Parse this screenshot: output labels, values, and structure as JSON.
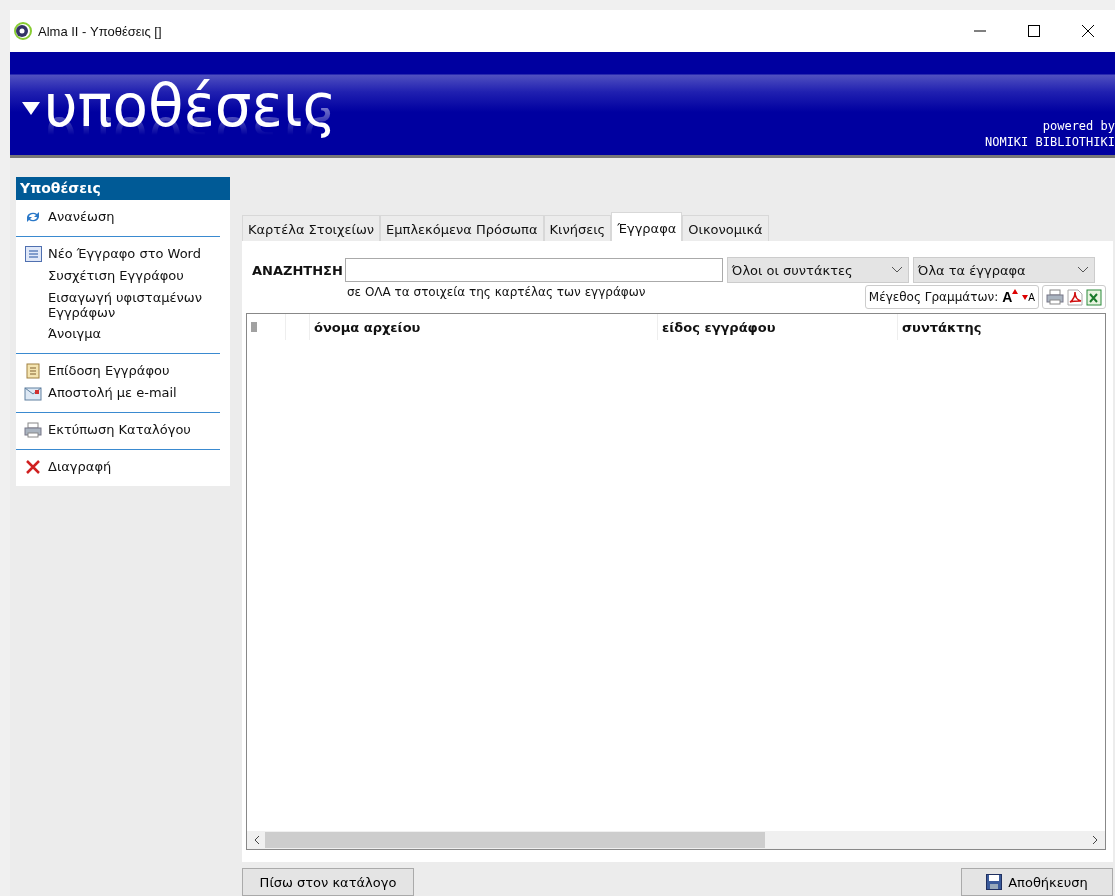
{
  "window": {
    "title": "Alma II - Υποθέσεις []"
  },
  "banner": {
    "title": "υποθέσεις",
    "powered_by": "powered by",
    "brand": "NOMIKI BIBLIOTHIKI"
  },
  "sidebar": {
    "title": "Υποθέσεις",
    "groups": [
      [
        {
          "label": "Ανανέωση",
          "kind": "refresh"
        }
      ],
      [
        {
          "label": "Νέο Έγγραφο στο Word",
          "kind": "word"
        },
        {
          "label": "Συσχέτιση Εγγράφου",
          "kind": "plain"
        },
        {
          "label": "Εισαγωγή υφισταμένων Εγγράφων",
          "kind": "plain"
        },
        {
          "label": "Άνοιγμα",
          "kind": "plain"
        }
      ],
      [
        {
          "label": "Επίδοση Εγγράφου",
          "kind": "scroll"
        },
        {
          "label": "Αποστολή με e-mail",
          "kind": "mail"
        }
      ],
      [
        {
          "label": "Εκτύπωση Καταλόγου",
          "kind": "print"
        }
      ],
      [
        {
          "label": "Διαγραφή",
          "kind": "delete"
        }
      ]
    ]
  },
  "tabs": [
    {
      "label": "Καρτέλα Στοιχείων",
      "selected": false
    },
    {
      "label": "Εμπλεκόμενα Πρόσωπα",
      "selected": false
    },
    {
      "label": "Κινήσεις",
      "selected": false
    },
    {
      "label": "Έγγραφα",
      "selected": true
    },
    {
      "label": "Οικονομικά",
      "selected": false
    }
  ],
  "search": {
    "label": "ΑΝΑΖΗΤΗΣΗ",
    "hint": "σε ΟΛΑ τα στοιχεία της καρτέλας των εγγράφων"
  },
  "filters": [
    {
      "value": "Όλοι οι συντάκτες"
    },
    {
      "value": "Όλα τα έγγραφα"
    }
  ],
  "font_size": {
    "label": "Μέγεθος Γραμμάτων:",
    "larger": "A",
    "smaller": "A"
  },
  "table": {
    "columns": [
      "όνομα αρχείου",
      "είδος εγγράφου",
      "συντάκτης"
    ]
  },
  "buttons": {
    "back": "Πίσω στον κατάλογο",
    "save": "Αποθήκευση"
  }
}
